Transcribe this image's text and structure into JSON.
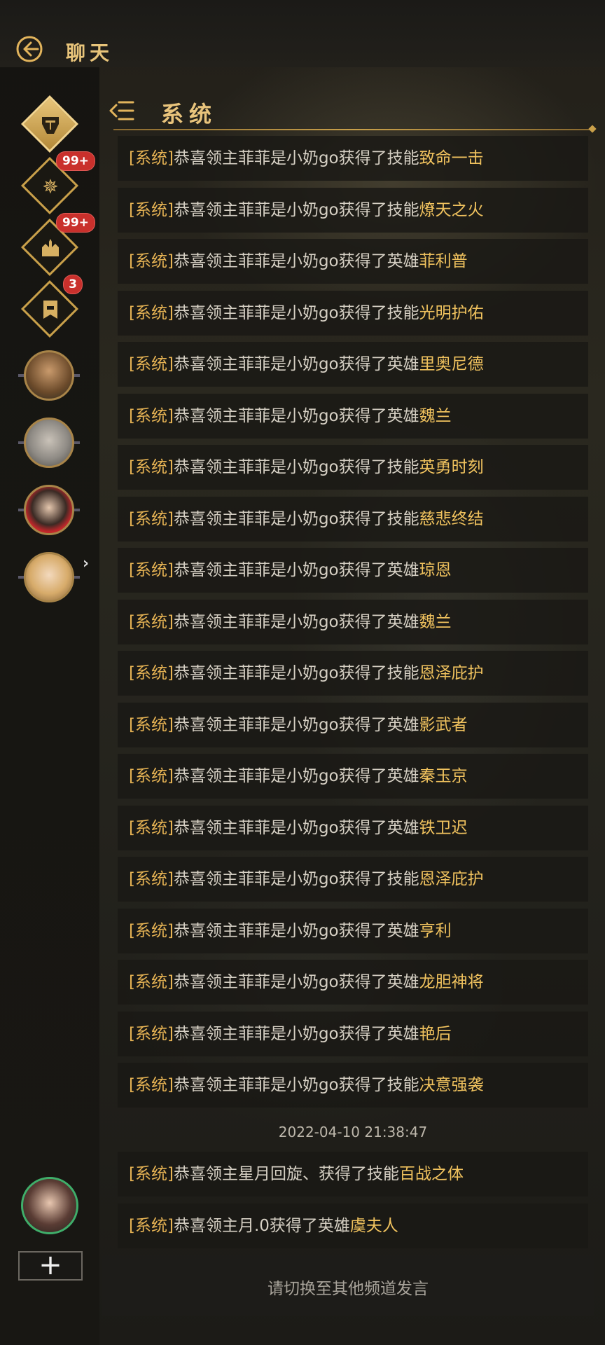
{
  "app": {
    "title": "聊天"
  },
  "sidebar": {
    "badges": [
      "99+",
      "99+",
      "3"
    ]
  },
  "channel": {
    "title": "系统"
  },
  "messages": [
    {
      "tag": "[系统]",
      "text": "恭喜领主菲菲是小奶go获得了技能",
      "highlight": "致命一击"
    },
    {
      "tag": "[系统]",
      "text": "恭喜领主菲菲是小奶go获得了技能",
      "highlight": "燎天之火"
    },
    {
      "tag": "[系统]",
      "text": "恭喜领主菲菲是小奶go获得了英雄",
      "highlight": "菲利普"
    },
    {
      "tag": "[系统]",
      "text": "恭喜领主菲菲是小奶go获得了技能",
      "highlight": "光明护佑"
    },
    {
      "tag": "[系统]",
      "text": "恭喜领主菲菲是小奶go获得了英雄",
      "highlight": "里奥尼德"
    },
    {
      "tag": "[系统]",
      "text": "恭喜领主菲菲是小奶go获得了英雄",
      "highlight": "魏兰"
    },
    {
      "tag": "[系统]",
      "text": "恭喜领主菲菲是小奶go获得了技能",
      "highlight": "英勇时刻"
    },
    {
      "tag": "[系统]",
      "text": "恭喜领主菲菲是小奶go获得了技能",
      "highlight": "慈悲终结"
    },
    {
      "tag": "[系统]",
      "text": "恭喜领主菲菲是小奶go获得了英雄",
      "highlight": "琼恩"
    },
    {
      "tag": "[系统]",
      "text": "恭喜领主菲菲是小奶go获得了英雄",
      "highlight": "魏兰"
    },
    {
      "tag": "[系统]",
      "text": "恭喜领主菲菲是小奶go获得了技能",
      "highlight": "恩泽庇护"
    },
    {
      "tag": "[系统]",
      "text": "恭喜领主菲菲是小奶go获得了英雄",
      "highlight": "影武者"
    },
    {
      "tag": "[系统]",
      "text": "恭喜领主菲菲是小奶go获得了英雄",
      "highlight": "秦玉京"
    },
    {
      "tag": "[系统]",
      "text": "恭喜领主菲菲是小奶go获得了英雄",
      "highlight": "铁卫迟"
    },
    {
      "tag": "[系统]",
      "text": "恭喜领主菲菲是小奶go获得了技能",
      "highlight": "恩泽庇护"
    },
    {
      "tag": "[系统]",
      "text": "恭喜领主菲菲是小奶go获得了英雄",
      "highlight": "亨利"
    },
    {
      "tag": "[系统]",
      "text": "恭喜领主菲菲是小奶go获得了英雄",
      "highlight": "龙胆神将"
    },
    {
      "tag": "[系统]",
      "text": "恭喜领主菲菲是小奶go获得了英雄",
      "highlight": "艳后"
    },
    {
      "tag": "[系统]",
      "text": "恭喜领主菲菲是小奶go获得了技能",
      "highlight": "决意强袭"
    }
  ],
  "timestamp": "2022-04-10 21:38:47",
  "recent_messages": [
    {
      "tag": "[系统]",
      "text": "恭喜领主星月回旋、获得了技能",
      "highlight": "百战之体"
    },
    {
      "tag": "[系统]",
      "text": "恭喜领主月.0获得了英雄",
      "highlight": "虞夫人"
    }
  ],
  "input": {
    "placeholder": "请切换至其他频道发言"
  },
  "colors": {
    "accent": "#e6b354",
    "badge": "#c9302c",
    "text": "#d6d0c4"
  }
}
